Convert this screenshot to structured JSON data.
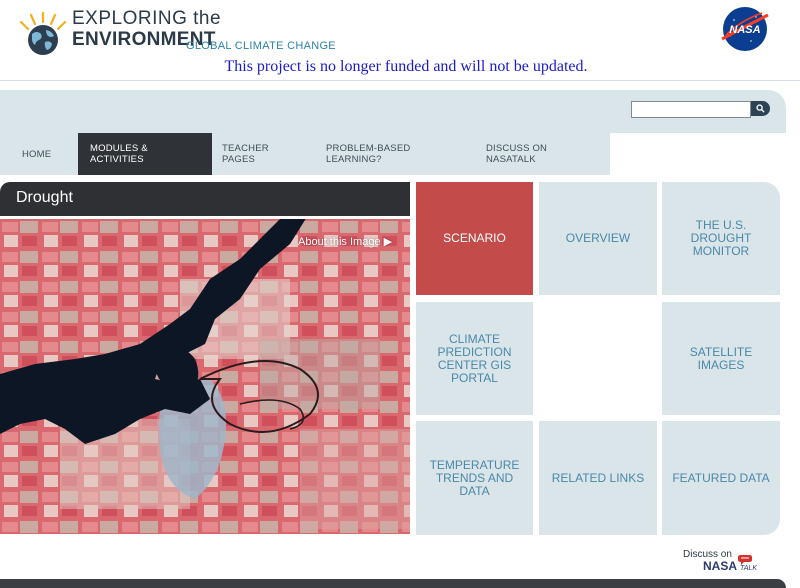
{
  "header": {
    "logo_line1": "EXPLORING the",
    "logo_line2": "ENVIRONMENT",
    "logo_sub": "GLOBAL CLIMATE CHANGE",
    "agency_logo": "NASA",
    "notice": "This project is no longer funded and will not be updated."
  },
  "search": {
    "value": "",
    "button_icon": "search-icon"
  },
  "nav": {
    "items": [
      {
        "label": "HOME",
        "active": false
      },
      {
        "label": "MODULES & ACTIVITIES",
        "active": true
      },
      {
        "label": "TEACHER PAGES",
        "active": false
      },
      {
        "label": "PROBLEM-BASED LEARNING?",
        "active": false
      },
      {
        "label": "DISCUSS ON NASATALK",
        "active": false
      }
    ]
  },
  "module": {
    "title": "Drought",
    "about_link": "About this Image ▶"
  },
  "tiles": [
    {
      "label": "SCENARIO",
      "active": true
    },
    {
      "label": "OVERVIEW",
      "active": false
    },
    {
      "label": "THE U.S. DROUGHT MONITOR",
      "active": false
    },
    {
      "label": "CLIMATE PREDICTION CENTER GIS PORTAL",
      "active": false
    },
    {
      "label": "",
      "active": false
    },
    {
      "label": "SATELLITE IMAGES",
      "active": false
    },
    {
      "label": "TEMPERATURE TRENDS AND DATA",
      "active": false
    },
    {
      "label": "RELATED LINKS",
      "active": false
    },
    {
      "label": "FEATURED DATA",
      "active": false
    }
  ],
  "footer": {
    "discuss_label": "Discuss on",
    "nasatalk_label": "NASA",
    "talk_label": "TALK"
  },
  "colors": {
    "accent": "#c34c4b",
    "nav_active": "#2f3236",
    "panel": "#dae5ea",
    "tile_text": "#4a88a8",
    "notice_text": "#1a1acc"
  }
}
